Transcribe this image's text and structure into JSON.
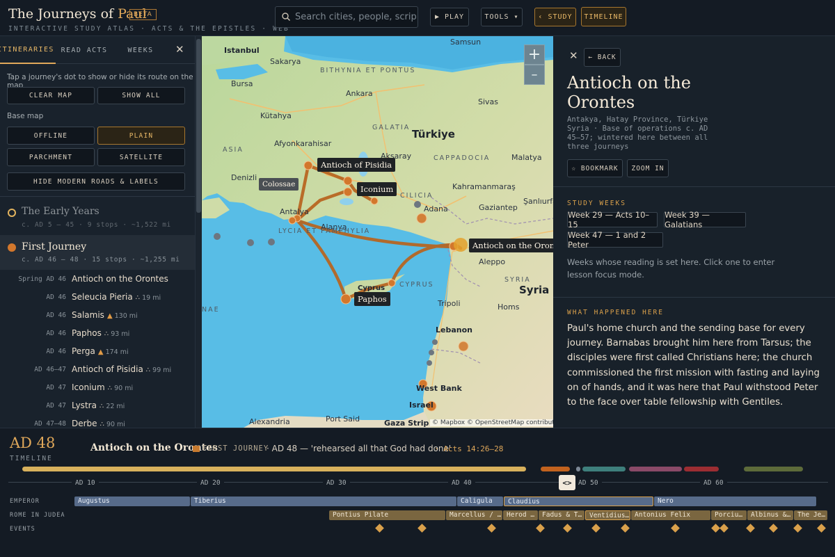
{
  "app": {
    "title_main": "The Journeys of ",
    "title_accent": "Paul",
    "badge": "BETA",
    "subtitle": "INTERACTIVE STUDY ATLAS · ACTS & THE EPISTLES · WEB"
  },
  "search": {
    "placeholder": "Search cities, people, scripture"
  },
  "toolbar": {
    "play": "▶ PLAY",
    "tools": "TOOLS ▾",
    "study": "‹ STUDY",
    "timeline": "TIMELINE"
  },
  "left": {
    "tabs": [
      "ITINERARIES",
      "READ ACTS",
      "WEEKS"
    ],
    "close": "✕",
    "hint": "Tap a journey's dot to show or hide its route on the map",
    "clear_map": "CLEAR MAP",
    "show_all": "SHOW ALL",
    "base_map_label": "Base map",
    "base_maps": [
      "OFFLINE",
      "PLAIN",
      "PARCHMENT",
      "SATELLITE"
    ],
    "selected_base_map": "PLAIN",
    "hide_roads": "HIDE MODERN ROADS & LABELS",
    "journeys": [
      {
        "name": "The Early Years",
        "meta": "c. AD 5 – 45 · 9 stops · ~1,522 mi",
        "color": "#e3b45e"
      },
      {
        "name": "First Journey",
        "meta": "c. AD 46 – 48 · 15 stops · ~1,255 mi",
        "color": "#d2772c"
      }
    ],
    "stops": [
      {
        "date": "Spring AD 46",
        "place": "Antioch on the Orontes",
        "dist": "",
        "icon": ""
      },
      {
        "date": "AD 46",
        "place": "Seleucia Pieria",
        "dist": "19 mi",
        "icon": "∴"
      },
      {
        "date": "AD 46",
        "place": "Salamis",
        "dist": "130 mi",
        "icon": "▲"
      },
      {
        "date": "AD 46",
        "place": "Paphos",
        "dist": "93 mi",
        "icon": "∴"
      },
      {
        "date": "AD 46",
        "place": "Perga",
        "dist": "174 mi",
        "icon": "▲"
      },
      {
        "date": "AD 46–47",
        "place": "Antioch of Pisidia",
        "dist": "99 mi",
        "icon": "∴"
      },
      {
        "date": "AD 47",
        "place": "Iconium",
        "dist": "90 mi",
        "icon": "∴"
      },
      {
        "date": "AD 47",
        "place": "Lystra",
        "dist": "22 mi",
        "icon": "∴"
      },
      {
        "date": "AD 47–48",
        "place": "Derbe",
        "dist": "90 mi",
        "icon": "∴"
      }
    ]
  },
  "map": {
    "zoom_in": "+",
    "zoom_out": "–",
    "labels": {
      "istanbul": "Istanbul",
      "sakarya": "Sakarya",
      "bithynia": "BITHYNIA ET PONTUS",
      "samsun": "Samsun",
      "bursa": "Bursa",
      "ankara": "Ankara",
      "kutahya": "Kütahya",
      "galatia": "GALATIA",
      "sivas": "Sivas",
      "asia": "ASIA",
      "afyon": "Afyonkarahisar",
      "turkiye": "Türkiye",
      "aksaray": "Aksaray",
      "cappadocia": "CAPPADOCIA",
      "malatya": "Malatya",
      "denizli": "Denizli",
      "kahramanmaras": "Kahramanmaraş",
      "cilicia": "CILICIA",
      "antalya": "Antalya",
      "adana": "Adana",
      "gaziantep": "Gaziantep",
      "sanliurfa": "Şanlıurfa",
      "alanya": "Alanya",
      "lycia": "LYCIA ET PAMPHYLIA",
      "cyprus_ter": "CYPRUS",
      "cyprus": "Cyprus",
      "tripoli": "Tripoli",
      "syria": "Syria",
      "syria_ter": "SYRIA",
      "homs": "Homs",
      "lebanon": "Lebanon",
      "westbank": "West Bank",
      "israel": "Israel",
      "alexandria": "Alexandria",
      "portsaid": "Port Said",
      "gaza": "Gaza Strip",
      "aegean": "NAE",
      "aleppo": "Aleppo"
    },
    "tags": {
      "antioch_pisidia": "Antioch of Pisidia",
      "iconium": "Iconium",
      "colossae": "Colossae",
      "antioch_orontes": "Antioch on the Orontes",
      "paphos": "Paphos"
    },
    "attribution": "© Mapbox © OpenStreetMap contributors",
    "route_color": "#b8641f"
  },
  "right": {
    "close": "✕",
    "back": "← BACK",
    "title": "Antioch on the Orontes",
    "subtitle": "Antakya, Hatay Province, Türkiye Syria · Base of operations c. AD 45–57; wintered here between all three journeys",
    "bookmark": "☆ BOOKMARK",
    "zoom_in": "ZOOM IN",
    "study_weeks_heading": "STUDY WEEKS",
    "weeks": [
      "Week 29 — Acts 10–15",
      "Week 39 — Galatians",
      "Week 47 — 1 and 2 Peter"
    ],
    "weeks_note": "Weeks whose reading is set here. Click one to enter lesson focus mode.",
    "what_heading": "WHAT HAPPENED HERE",
    "what_text": "Paul's home church and the sending base for every journey. Barnabas brought him here from Tarsus; the disciples were first called Christians here; the church commissioned the first mission with fasting and laying on of hands, and it was here that Paul withstood Peter to the face over table fellowship with Gentiles."
  },
  "timeline": {
    "year": "AD 48",
    "label": "TIMELINE",
    "place": "Antioch on the Orontes",
    "journey": "FIRST JOURNEY",
    "event": "· AD 48 — 'rehearsed all that God had done'",
    "ref": "· Acts 14:26–28",
    "ticks": [
      "AD 10",
      "AD 20",
      "AD 30",
      "AD 40",
      "AD 50",
      "AD 60"
    ],
    "handle": "<>",
    "row_labels": [
      "EMPEROR",
      "ROME IN JUDEA",
      "EVENTS"
    ],
    "emperors": [
      "Augustus",
      "Tiberius",
      "Caligula",
      "Claudius",
      "Nero"
    ],
    "governors": [
      "Pontius Pilate",
      "Marcellus / …",
      "Herod …",
      "Fadus & T…",
      "Ventidius…",
      "Antonius Felix",
      "Porciu…",
      "Albinus &…",
      "The Je…"
    ]
  }
}
